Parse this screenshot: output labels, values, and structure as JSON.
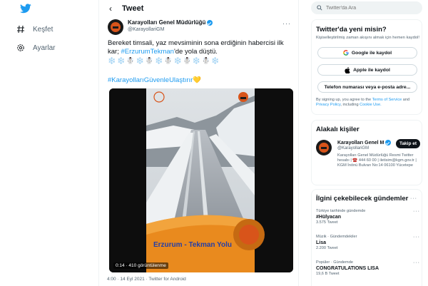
{
  "nav": {
    "logo_icon": "twitter-bird-icon",
    "items": [
      {
        "label": "Keşfet",
        "icon": "hashtag-icon"
      },
      {
        "label": "Ayarlar",
        "icon": "gear-icon"
      }
    ]
  },
  "header": {
    "back_icon": "arrow-left-icon",
    "title": "Tweet"
  },
  "tweet": {
    "author_name": "Karayolları Genel Müdürlüğü",
    "author_handle": "@KarayollariGM",
    "text_pre": "Bereket timsali, yaz mevsiminin sona erdiğinin habercisi ilk kar; ",
    "hashtag1": "#ErzurumTekman",
    "text_post": "'de yola düştü.",
    "snow_line": "❄️❄️☃️❄️☃️❄️☃️❄️☃️❄️☃️❄️",
    "hashtag2": "#KarayollarıGüvenleUlaştırır",
    "hashtag2_emoji": "💛",
    "video_caption": "Erzurum - Tekman Yolu",
    "video_time": "0:14 · 410 görüntülenme",
    "meta": "4:00 · 14 Eyl 2021 · Twitter for Android"
  },
  "search": {
    "placeholder": "Twitter'da Ara"
  },
  "signup": {
    "title": "Twitter'da yeni misin?",
    "subtitle": "Kişiselleştirilmiş zaman akışını almak için hemen kaydol!",
    "google": "Google ile kaydol",
    "apple": "Apple ile kaydol",
    "phone": "Telefon numarası veya e-posta adre...",
    "legal_pre": "By signing up, you agree to the ",
    "legal_terms": "Terms of Service",
    "legal_mid": " and ",
    "legal_privacy": "Privacy Policy",
    "legal_post": ", including ",
    "legal_cookie": "Cookie Use."
  },
  "related": {
    "title": "Alakalı kişiler",
    "name": "Karayolları Genel M",
    "handle": "@KarayollariGM",
    "follow": "Takip et",
    "bio": "Karayolları Genel Müdürlüğü Resmi Twitter hesabı | ☎️ 444 60 00 | iletisim@kgm.gov.tr | KGM İnönü Bulvarı No:14 06100 Yücetepe"
  },
  "trends": {
    "title": "İlgini çekebilecek gündemler",
    "items": [
      {
        "context": "Türkiye tarihinde gündemde",
        "name": "#Hülyacan",
        "count": "3.575 Tweet"
      },
      {
        "context": "Müzik · Gündemdekiler",
        "name": "Lisa",
        "count": "2.200 Tweet"
      },
      {
        "context": "Popüler · Gündemde",
        "name": "CONGRATULATIONS LISA",
        "count": "19,6 B Tweet"
      }
    ]
  }
}
